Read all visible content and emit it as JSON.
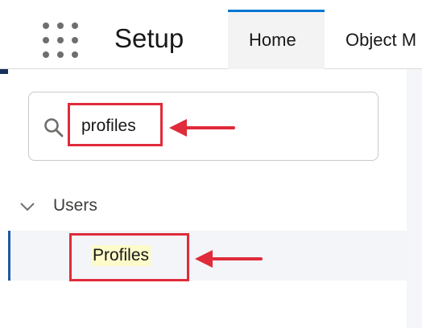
{
  "header": {
    "app_title": "Setup",
    "tabs": [
      {
        "label": "Home",
        "active": true
      },
      {
        "label": "Object M",
        "active": false
      }
    ]
  },
  "search": {
    "value": "profiles"
  },
  "tree": {
    "group_label": "Users",
    "selected_item_label": "Profiles"
  },
  "annotations": {
    "highlight_color": "#e02b3a",
    "text_highlight_color": "#fdfbc9"
  },
  "icons": [
    "app-launcher-icon",
    "search-icon",
    "chevron-down-icon",
    "arrow-left-icon"
  ]
}
